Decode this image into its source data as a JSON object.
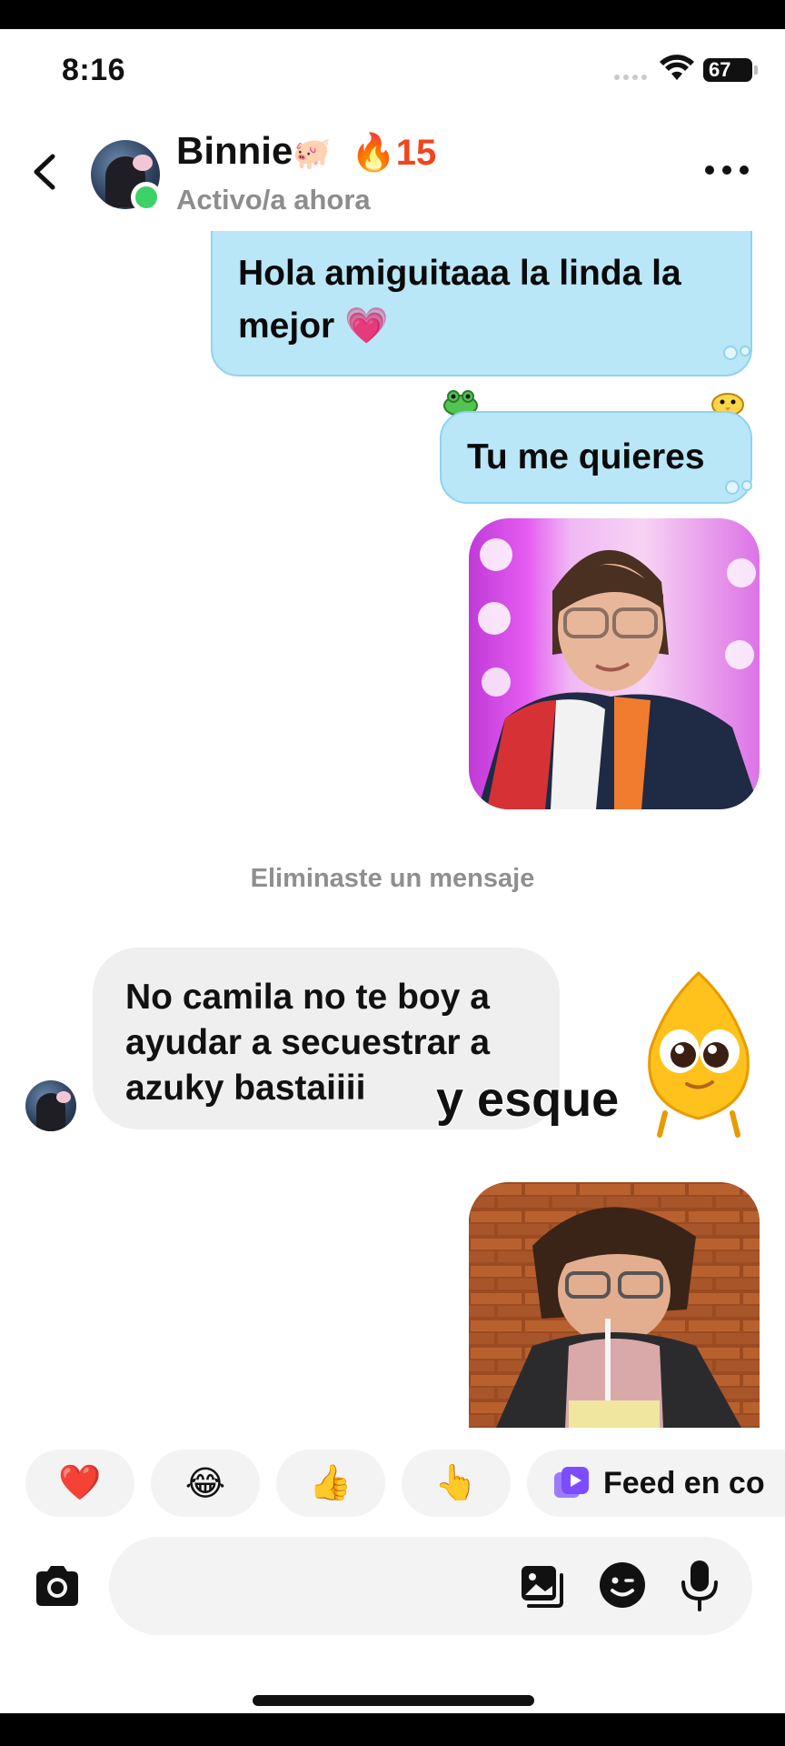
{
  "status_bar": {
    "time": "8:16",
    "battery": "67"
  },
  "header": {
    "name": "Binnie",
    "name_emoji": "🐖",
    "streak": "🔥15",
    "status": "Activo/a ahora",
    "icons": {
      "back": "chevron-left-icon",
      "more": "more-dots-icon"
    }
  },
  "messages": {
    "sent_1": "Hola amiguitaaa la linda la mejor 💗",
    "sent_2": "Tu me quieres",
    "system_note": "Eliminaste un mensaje",
    "received_1": "No camila no te boy a ayudar a secuestrar a azuky bastaiiii"
  },
  "overlay": {
    "caption": "y esque"
  },
  "quick_replies": {
    "reactions": [
      "❤️",
      "😂",
      "👍",
      "👆"
    ],
    "feed_label": "Feed en co"
  },
  "composer": {
    "placeholder": "",
    "icons": [
      "camera-icon",
      "gallery-icon",
      "sticker-icon",
      "microphone-icon"
    ]
  },
  "colors": {
    "sent_bubble": "#b9e7f8",
    "received_bubble": "#efefef",
    "streak": "#f2441d",
    "online": "#3bd267",
    "feed_icon": "#7b4dff"
  }
}
